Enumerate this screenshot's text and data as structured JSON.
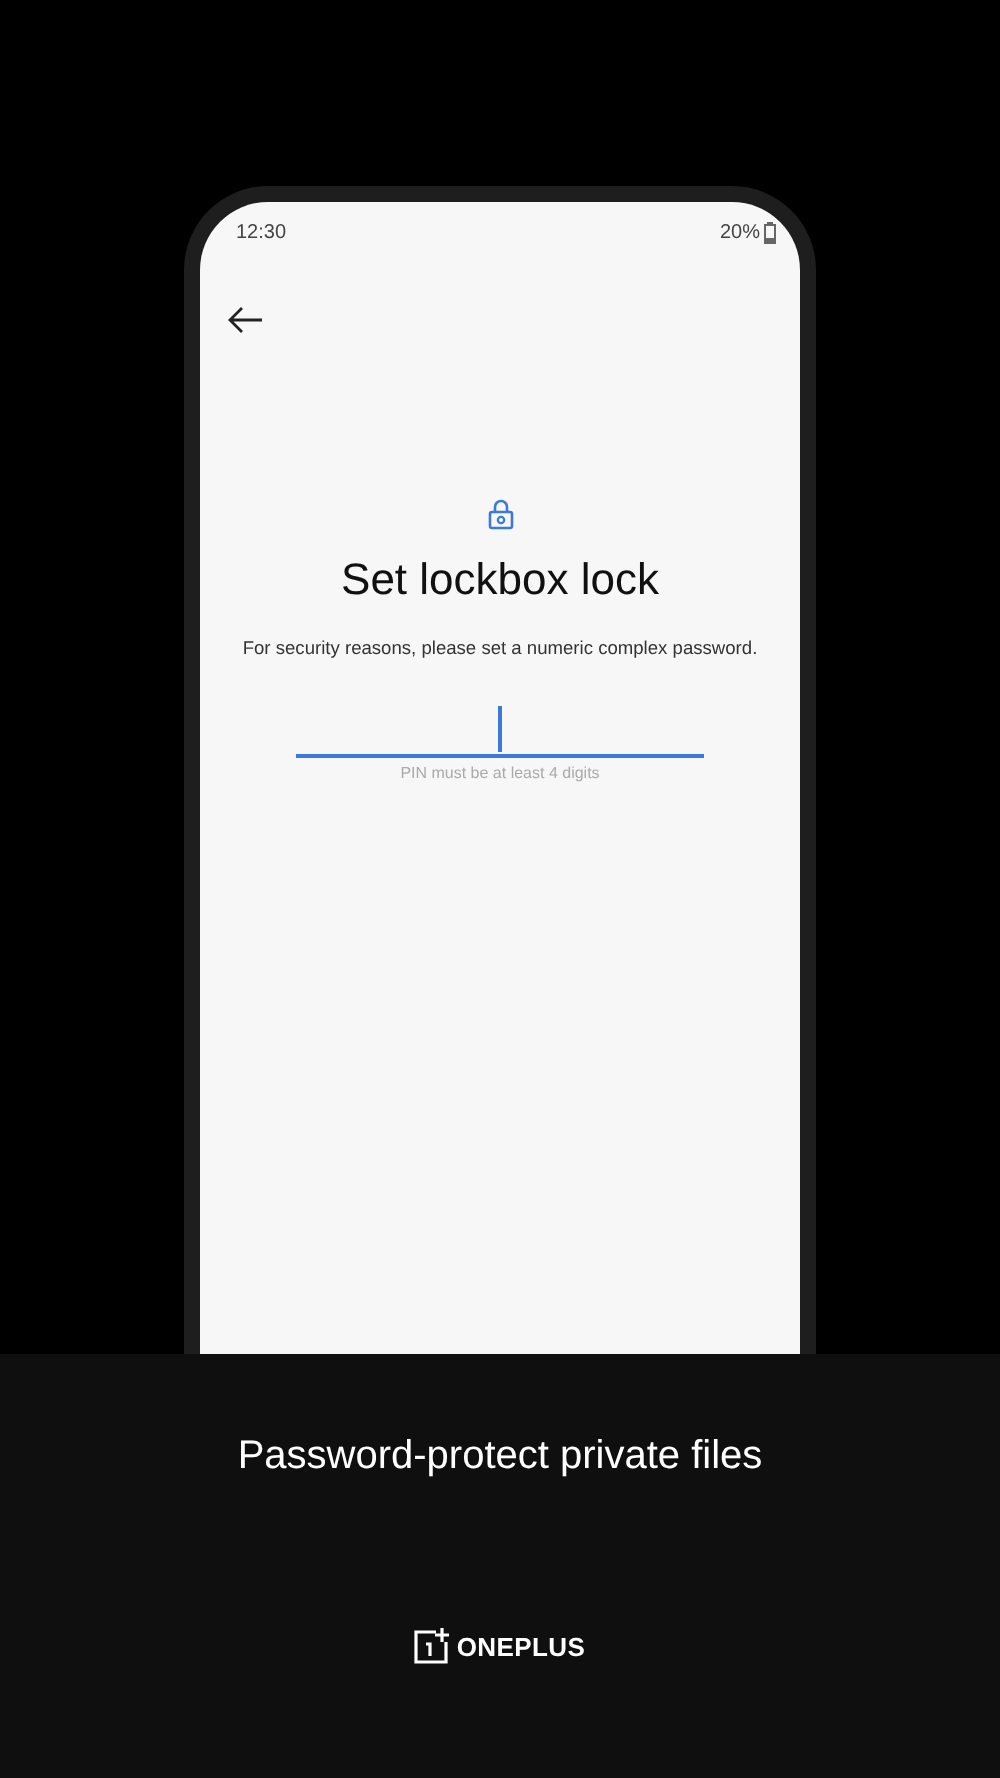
{
  "status_bar": {
    "time": "12:30",
    "battery": "20%"
  },
  "screen": {
    "title": "Set lockbox lock",
    "description": "For security reasons, please set a numeric complex password.",
    "pin_field": {
      "focused": true,
      "hint": "PIN must be at least 4 digits"
    }
  },
  "caption": "Password-protect private files",
  "brand": "ONEPLUS"
}
